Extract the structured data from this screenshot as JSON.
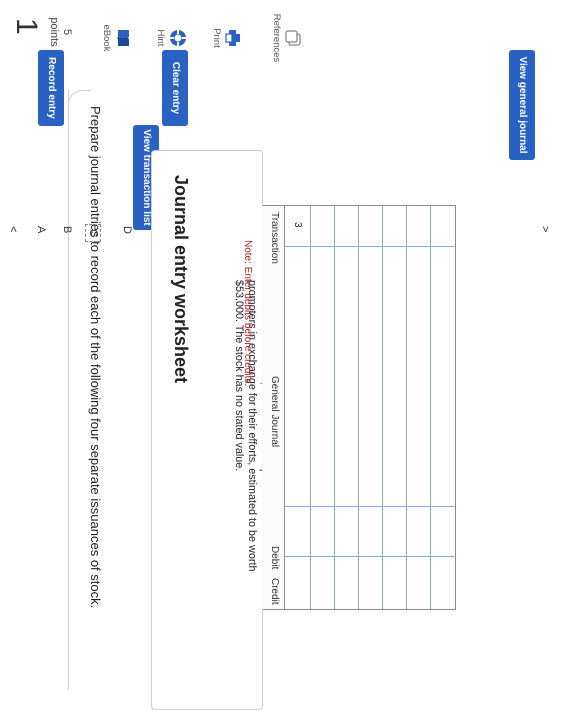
{
  "question": {
    "number": "1",
    "points_value": "5",
    "points_label": "points"
  },
  "rail": [
    {
      "label": "eBook",
      "icon": "book-icon"
    },
    {
      "label": "Hint",
      "icon": "lifebuoy-icon"
    },
    {
      "label": "Print",
      "icon": "printer-icon"
    },
    {
      "label": "References",
      "icon": "copy-icon"
    }
  ],
  "prompt": "Prepare journal entries to record each of the following four separate issuances of stock.",
  "view_transaction_list": "View transaction list",
  "worksheet": {
    "title": "Journal entry worksheet",
    "tabs": [
      "A",
      "B",
      "C",
      "D"
    ],
    "active_tab": "C",
    "description": "Record the issue of 1,500 shares of no-par common stock to its promoters in exchange for their efforts, estimated to be worth $53,000. The stock has no stated value.",
    "note_label": "Note: Enter debits before credits."
  },
  "table": {
    "headers": {
      "transaction": "Transaction",
      "general_journal": "General Journal",
      "debit": "Debit",
      "credit": "Credit"
    },
    "first_transaction": "3"
  },
  "buttons": {
    "record_entry": "Record entry",
    "clear_entry": "Clear entry",
    "view_general_journal": "View general journal"
  },
  "colors": {
    "accent": "#2a62c4",
    "note_red": "#b21f1f"
  }
}
